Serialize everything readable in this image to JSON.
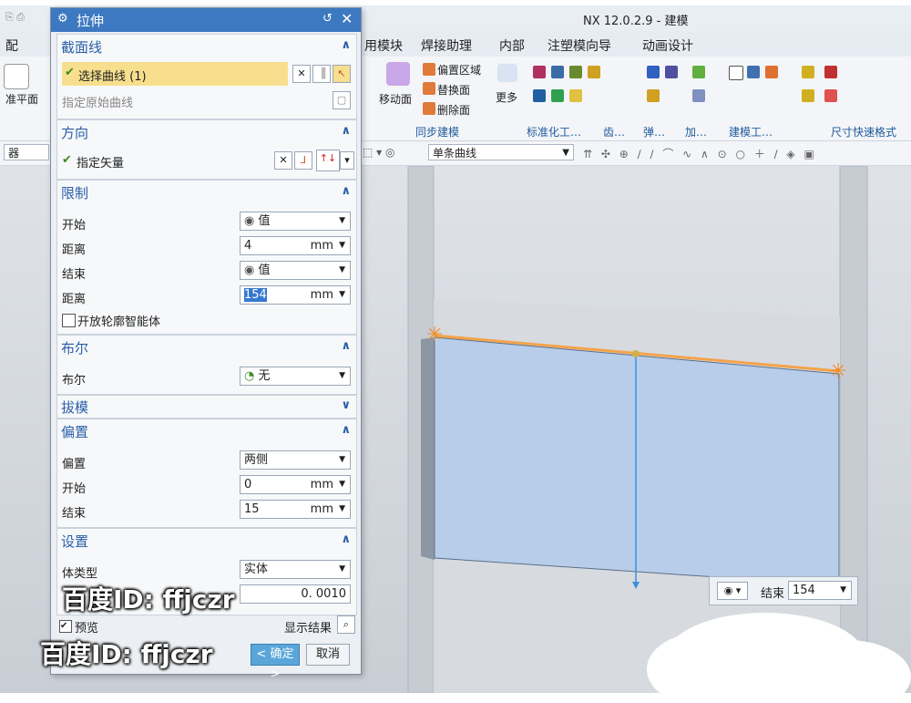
{
  "app_title": "NX 12.0.2.9 - 建模",
  "menu": [
    "配",
    "用模块",
    "焊接助理",
    "内部",
    "注塑模向导",
    "动画设计"
  ],
  "ribbon": {
    "left_label": "准平面",
    "buttons": {
      "move_face": "移动面",
      "offset_region": "偏置区域",
      "replace_face": "替换面",
      "delete_face": "删除面",
      "more": "更多"
    },
    "groups": [
      "同步建模",
      "标准化工…",
      "齿…",
      "弹…",
      "加…",
      "建模工…",
      "尺寸快速格式"
    ]
  },
  "toolbar2": {
    "left_combo": "器",
    "curve_rule": "单条曲线"
  },
  "dialog": {
    "title": "拉伸",
    "sections": {
      "section_curve": {
        "title": "截面线",
        "selected": "选择曲线 (1)",
        "origin_curve": "指定原始曲线"
      },
      "direction": {
        "title": "方向",
        "vector": "指定矢量"
      },
      "limits": {
        "title": "限制",
        "start_label": "开始",
        "start_value": "值",
        "distance1_label": "距离",
        "distance1": "4",
        "end_label": "结束",
        "end_value": "值",
        "distance2_label": "距离",
        "distance2": "154",
        "unit": "mm",
        "open_profile": "开放轮廓智能体"
      },
      "boolean": {
        "title": "布尔",
        "label": "布尔",
        "value": "无"
      },
      "draft": {
        "title": "拔模"
      },
      "offset": {
        "title": "偏置",
        "offset_label": "偏置",
        "offset_value": "两侧",
        "start_label": "开始",
        "start": "0",
        "end_label": "结束",
        "end": "15",
        "unit": "mm"
      },
      "settings": {
        "title": "设置",
        "body_type_label": "体类型",
        "body_type": "实体",
        "tolerance": "0. 0010"
      }
    },
    "preview_label": "预览",
    "show_result": "显示结果",
    "ok": "< 确定 >",
    "cancel": "取消"
  },
  "popup": {
    "label": "结束",
    "value": "154"
  },
  "watermark": "百度ID: ffjczr"
}
